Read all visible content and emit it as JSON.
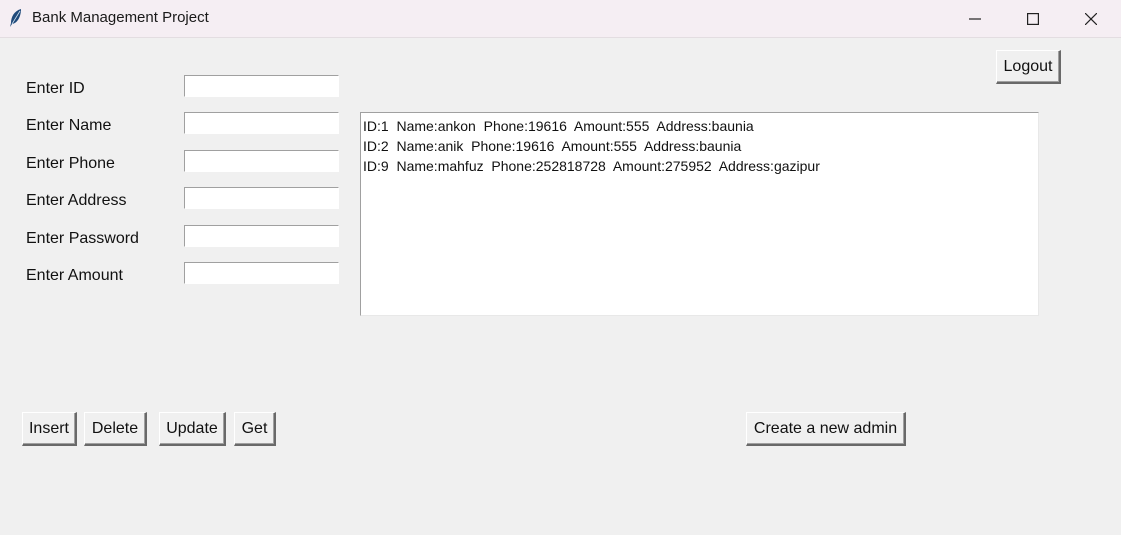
{
  "window": {
    "title": "Bank Management Project",
    "app_icon": "feather-icon",
    "controls": [
      "minimize-icon",
      "maximize-icon",
      "close-icon"
    ]
  },
  "form": {
    "fields": [
      {
        "label": "Enter ID",
        "value": ""
      },
      {
        "label": "Enter Name",
        "value": ""
      },
      {
        "label": "Enter Phone",
        "value": ""
      },
      {
        "label": "Enter Address",
        "value": ""
      },
      {
        "label": "Enter Password",
        "value": ""
      },
      {
        "label": "Enter Amount",
        "value": ""
      }
    ]
  },
  "listbox": {
    "rows": [
      "ID:1  Name:ankon  Phone:19616  Amount:555  Address:baunia",
      "ID:2  Name:anik  Phone:19616  Amount:555  Address:baunia",
      "ID:9  Name:mahfuz  Phone:252818728  Amount:275952  Address:gazipur"
    ]
  },
  "buttons": {
    "logout": "Logout",
    "insert": "Insert",
    "delete": "Delete",
    "update": "Update",
    "get": "Get",
    "create_admin": "Create a new admin"
  }
}
